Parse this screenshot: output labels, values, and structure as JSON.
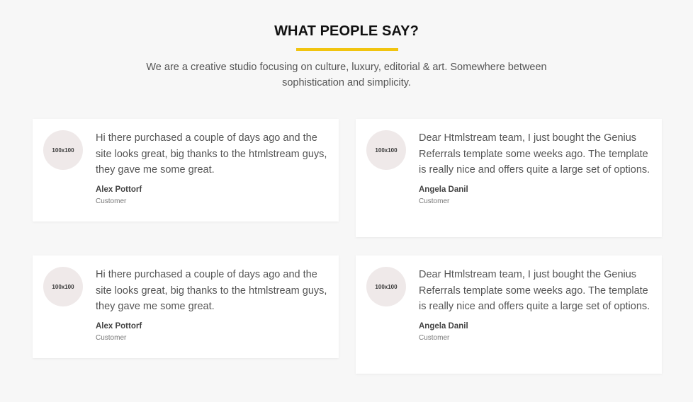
{
  "section": {
    "title": "WHAT PEOPLE SAY?",
    "description": "We are a creative studio focusing on culture, luxury, editorial & art. Somewhere between sophistication and simplicity.",
    "accent_color": "#f1c40f"
  },
  "testimonials": [
    {
      "avatar_label": "100x100",
      "quote": "Hi there purchased a couple of days ago and the site looks great, big thanks to the htmlstream guys, they gave me some great.",
      "author": "Alex Pottorf",
      "role": "Customer"
    },
    {
      "avatar_label": "100x100",
      "quote": "Dear Htmlstream team, I just bought the Genius Referrals template some weeks ago. The template is really nice and offers quite a large set of options.",
      "author": "Angela Danil",
      "role": "Customer"
    },
    {
      "avatar_label": "100x100",
      "quote": "Hi there purchased a couple of days ago and the site looks great, big thanks to the htmlstream guys, they gave me some great.",
      "author": "Alex Pottorf",
      "role": "Customer"
    },
    {
      "avatar_label": "100x100",
      "quote": "Dear Htmlstream team, I just bought the Genius Referrals template some weeks ago. The template is really nice and offers quite a large set of options.",
      "author": "Angela Danil",
      "role": "Customer"
    }
  ]
}
